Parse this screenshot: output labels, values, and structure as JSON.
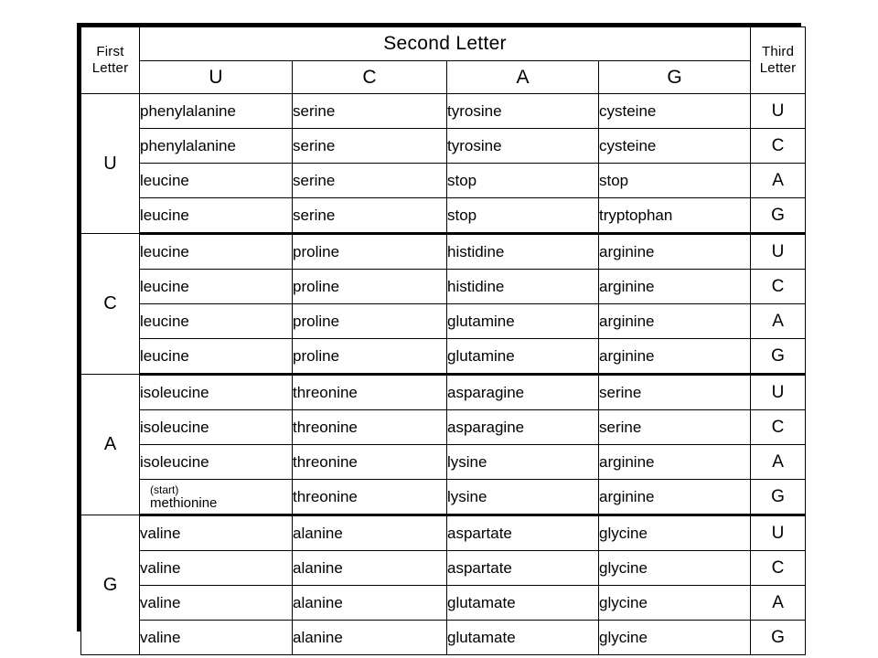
{
  "table": {
    "headers": {
      "first_letter": "First Letter",
      "first_letter_line1": "First",
      "first_letter_line2": "Letter",
      "second_letter": "Second Letter",
      "third_letter": "Third Letter",
      "third_letter_line1": "Third",
      "third_letter_line2": "Letter",
      "second_letter_bases": [
        "U",
        "C",
        "A",
        "G"
      ]
    },
    "blocks": [
      {
        "first_letter": "U",
        "rows": [
          {
            "third_letter": "U",
            "amino_acids": [
              "phenylalanine",
              "serine",
              "tyrosine",
              "cysteine"
            ]
          },
          {
            "third_letter": "C",
            "amino_acids": [
              "phenylalanine",
              "serine",
              "tyrosine",
              "cysteine"
            ]
          },
          {
            "third_letter": "A",
            "amino_acids": [
              "leucine",
              "serine",
              "stop",
              "stop"
            ]
          },
          {
            "third_letter": "G",
            "amino_acids": [
              "leucine",
              "serine",
              "stop",
              "tryptophan"
            ]
          }
        ]
      },
      {
        "first_letter": "C",
        "rows": [
          {
            "third_letter": "U",
            "amino_acids": [
              "leucine",
              "proline",
              "histidine",
              "arginine"
            ]
          },
          {
            "third_letter": "C",
            "amino_acids": [
              "leucine",
              "proline",
              "histidine",
              "arginine"
            ]
          },
          {
            "third_letter": "A",
            "amino_acids": [
              "leucine",
              "proline",
              "glutamine",
              "arginine"
            ]
          },
          {
            "third_letter": "G",
            "amino_acids": [
              "leucine",
              "proline",
              "glutamine",
              "arginine"
            ]
          }
        ]
      },
      {
        "first_letter": "A",
        "rows": [
          {
            "third_letter": "U",
            "amino_acids": [
              "isoleucine",
              "threonine",
              "asparagine",
              "serine"
            ]
          },
          {
            "third_letter": "C",
            "amino_acids": [
              "isoleucine",
              "threonine",
              "asparagine",
              "serine"
            ]
          },
          {
            "third_letter": "A",
            "amino_acids": [
              "isoleucine",
              "threonine",
              "lysine",
              "arginine"
            ]
          },
          {
            "third_letter": "G",
            "start_codon": true,
            "start_tag": "(start)",
            "start_name": "methionine",
            "amino_acids": [
              "(start) methionine",
              "threonine",
              "lysine",
              "arginine"
            ]
          }
        ]
      },
      {
        "first_letter": "G",
        "rows": [
          {
            "third_letter": "U",
            "amino_acids": [
              "valine",
              "alanine",
              "aspartate",
              "glycine"
            ]
          },
          {
            "third_letter": "C",
            "amino_acids": [
              "valine",
              "alanine",
              "aspartate",
              "glycine"
            ]
          },
          {
            "third_letter": "A",
            "amino_acids": [
              "valine",
              "alanine",
              "glutamate",
              "glycine"
            ]
          },
          {
            "third_letter": "G",
            "amino_acids": [
              "valine",
              "alanine",
              "glutamate",
              "glycine"
            ]
          }
        ]
      }
    ]
  },
  "colors": {
    "border": "#000000",
    "text": "#000000",
    "background": "#ffffff"
  }
}
